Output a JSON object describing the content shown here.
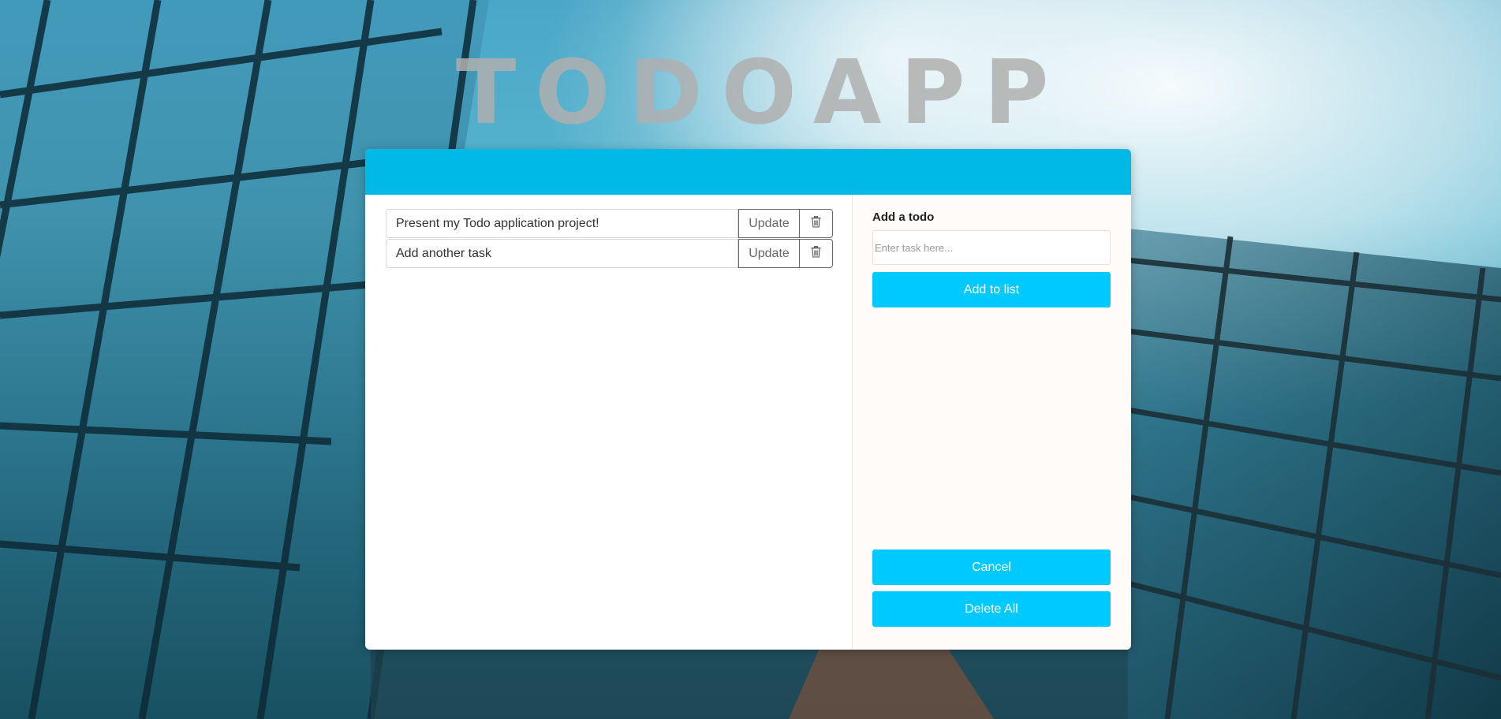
{
  "app": {
    "brand": "TODOAPP"
  },
  "todos": [
    {
      "text": "Present my Todo application project!",
      "update_label": "Update",
      "delete_icon": "trash-icon"
    },
    {
      "text": "Add another task",
      "update_label": "Update",
      "delete_icon": "trash-icon"
    }
  ],
  "side": {
    "label": "Add a todo",
    "input_placeholder": "Enter task here...",
    "input_value": "",
    "add_label": "Add to list",
    "cancel_label": "Cancel",
    "delete_all_label": "Delete All"
  },
  "colors": {
    "accent": "#00b9e6",
    "button": "#00c9ff",
    "side_bg": "#fffbf8"
  }
}
